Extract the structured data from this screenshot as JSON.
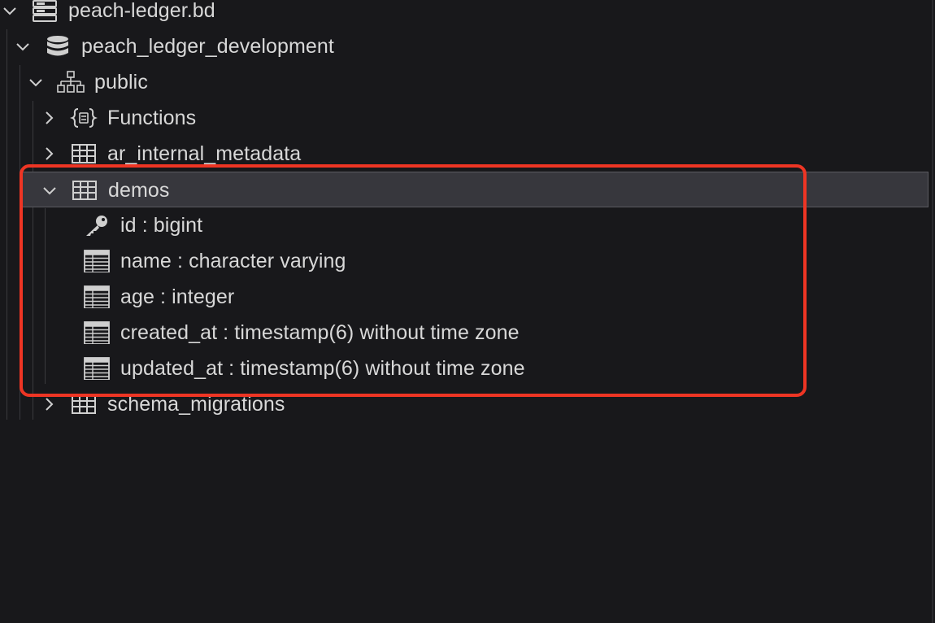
{
  "tree": {
    "server": {
      "label": "peach-ledger.bd",
      "icon": "server-icon"
    },
    "database": {
      "label": "peach_ledger_development",
      "icon": "database-icon"
    },
    "schema": {
      "label": "public",
      "icon": "schema-icon"
    },
    "functions": {
      "label": "Functions",
      "icon": "function-icon"
    },
    "tables": [
      {
        "label": "ar_internal_metadata",
        "icon": "table-icon",
        "expanded": false
      },
      {
        "label": "demos",
        "icon": "table-icon",
        "expanded": true,
        "selected": true
      },
      {
        "label": "schema_migrations",
        "icon": "table-icon",
        "expanded": false
      }
    ],
    "columns": [
      {
        "label": "id : bigint",
        "icon": "key-icon"
      },
      {
        "label": "name : character varying",
        "icon": "column-icon"
      },
      {
        "label": "age : integer",
        "icon": "column-icon"
      },
      {
        "label": "created_at : timestamp(6) without time zone",
        "icon": "column-icon"
      },
      {
        "label": "updated_at : timestamp(6) without time zone",
        "icon": "column-icon"
      }
    ]
  },
  "annotation": {
    "color": "#ee3524"
  },
  "colors": {
    "background": "#18181b",
    "selected": "#37373d",
    "text": "#d8d8d8"
  }
}
